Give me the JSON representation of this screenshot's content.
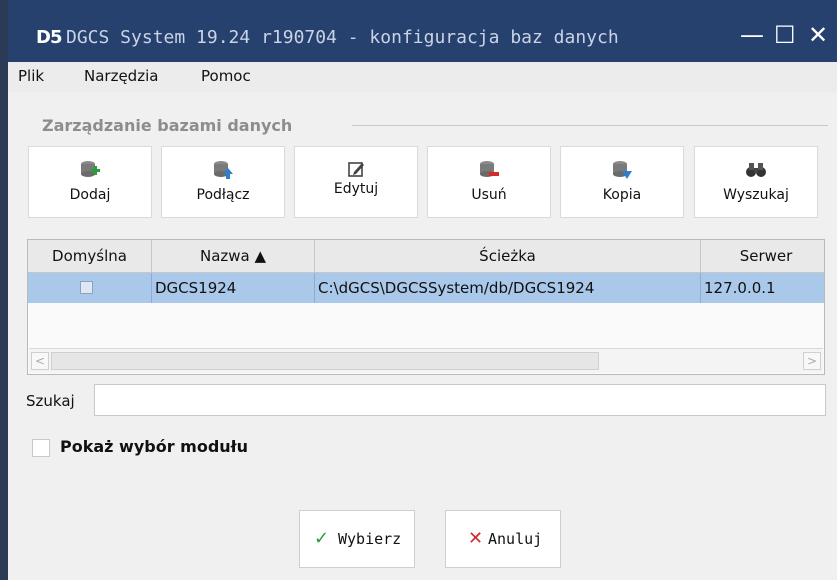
{
  "window": {
    "logo": "D5",
    "title": "DGCS System 19.24 r190704 - konfiguracja baz danych",
    "minimize": "—",
    "maximize": "☐",
    "close": "✕"
  },
  "menu": [
    "Plik",
    "Narzędzia",
    "Pomoc"
  ],
  "group_title": "Zarządzanie bazami danych",
  "toolbar": [
    {
      "label": "Dodaj",
      "icon": "database-add-icon"
    },
    {
      "label": "Podłącz",
      "icon": "database-connect-icon"
    },
    {
      "label": "Edytuj",
      "icon": "edit-icon"
    },
    {
      "label": "Usuń",
      "icon": "database-delete-icon"
    },
    {
      "label": "Kopia",
      "icon": "database-backup-icon"
    },
    {
      "label": "Wyszukaj",
      "icon": "binoculars-icon"
    }
  ],
  "table": {
    "columns": [
      "Domyślna",
      "Nazwa ▲",
      "Ścieżka",
      "Serwer"
    ],
    "rows": [
      {
        "default": true,
        "name": "DGCS1924",
        "path": "C:\\dGCS\\DGCSSystem/db/DGCS1924",
        "server": "127.0.0.1"
      }
    ]
  },
  "search": {
    "label": "Szukaj",
    "value": ""
  },
  "module_checkbox": {
    "label": "Pokaż wybór modułu",
    "checked": false
  },
  "buttons": {
    "ok": "Wybierz",
    "cancel": "Anuluj"
  },
  "colors": {
    "titlebar": "#27416f",
    "selection": "#a9c8ea",
    "ok_icon": "#2e9c3a",
    "cancel_icon": "#d42a2a"
  }
}
